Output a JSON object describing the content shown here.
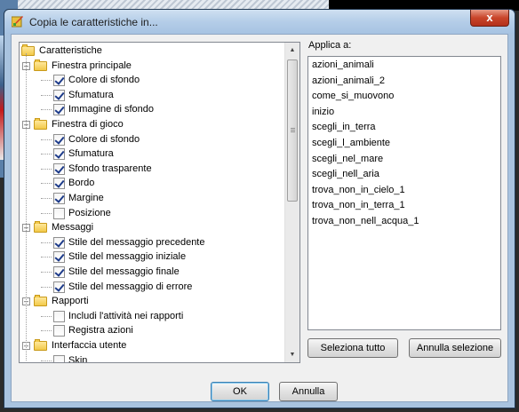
{
  "window": {
    "title": "Copia le caratteristiche in...",
    "close_label": "x"
  },
  "tree": {
    "items": [
      {
        "label": "Caratteristiche",
        "kind": "folder",
        "level": 0,
        "expanded": true
      },
      {
        "label": "Finestra principale",
        "kind": "folder",
        "level": 1,
        "expanded": true
      },
      {
        "label": "Colore di sfondo",
        "kind": "check",
        "level": 2,
        "checked": true
      },
      {
        "label": "Sfumatura",
        "kind": "check",
        "level": 2,
        "checked": true
      },
      {
        "label": "Immagine di sfondo",
        "kind": "check",
        "level": 2,
        "checked": true
      },
      {
        "label": "Finestra di gioco",
        "kind": "folder",
        "level": 1,
        "expanded": true
      },
      {
        "label": "Colore di sfondo",
        "kind": "check",
        "level": 2,
        "checked": true
      },
      {
        "label": "Sfumatura",
        "kind": "check",
        "level": 2,
        "checked": true
      },
      {
        "label": "Sfondo trasparente",
        "kind": "check",
        "level": 2,
        "checked": true
      },
      {
        "label": "Bordo",
        "kind": "check",
        "level": 2,
        "checked": true
      },
      {
        "label": "Margine",
        "kind": "check",
        "level": 2,
        "checked": true
      },
      {
        "label": "Posizione",
        "kind": "check",
        "level": 2,
        "checked": false
      },
      {
        "label": "Messaggi",
        "kind": "folder",
        "level": 1,
        "expanded": true
      },
      {
        "label": "Stile del messaggio precedente",
        "kind": "check",
        "level": 2,
        "checked": true
      },
      {
        "label": "Stile del messaggio iniziale",
        "kind": "check",
        "level": 2,
        "checked": true
      },
      {
        "label": "Stile del messaggio finale",
        "kind": "check",
        "level": 2,
        "checked": true
      },
      {
        "label": "Stile del messaggio di errore",
        "kind": "check",
        "level": 2,
        "checked": true
      },
      {
        "label": "Rapporti",
        "kind": "folder",
        "level": 1,
        "expanded": true
      },
      {
        "label": "Includi l'attività nei rapporti",
        "kind": "check",
        "level": 2,
        "checked": false
      },
      {
        "label": "Registra azioni",
        "kind": "check",
        "level": 2,
        "checked": false
      },
      {
        "label": "Interfaccia utente",
        "kind": "folder",
        "level": 1,
        "expanded": true
      },
      {
        "label": "Skin",
        "kind": "check",
        "level": 2,
        "checked": false
      }
    ]
  },
  "applica": {
    "label": "Applica a:",
    "items": [
      "azioni_animali",
      "azioni_animali_2",
      "come_si_muovono",
      "inizio",
      "scegli_in_terra",
      "scegli_l_ambiente",
      "scegli_nel_mare",
      "scegli_nell_aria",
      "trova_non_in_cielo_1",
      "trova_non_in_terra_1",
      "trova_non_nell_acqua_1"
    ]
  },
  "buttons": {
    "select_all": "Seleziona tutto",
    "deselect": "Annulla selezione",
    "ok": "OK",
    "cancel": "Annulla"
  },
  "icons": {
    "title": "copy-properties-icon",
    "folder": "folder-icon",
    "expander": "collapse-minus-icon",
    "scroll_up": "arrow-up-icon",
    "scroll_down": "arrow-down-icon"
  },
  "colors": {
    "titlebar": "#b4cde8",
    "close": "#c9452a",
    "folder": "#f2c94a",
    "check": "#1d3b8a"
  }
}
